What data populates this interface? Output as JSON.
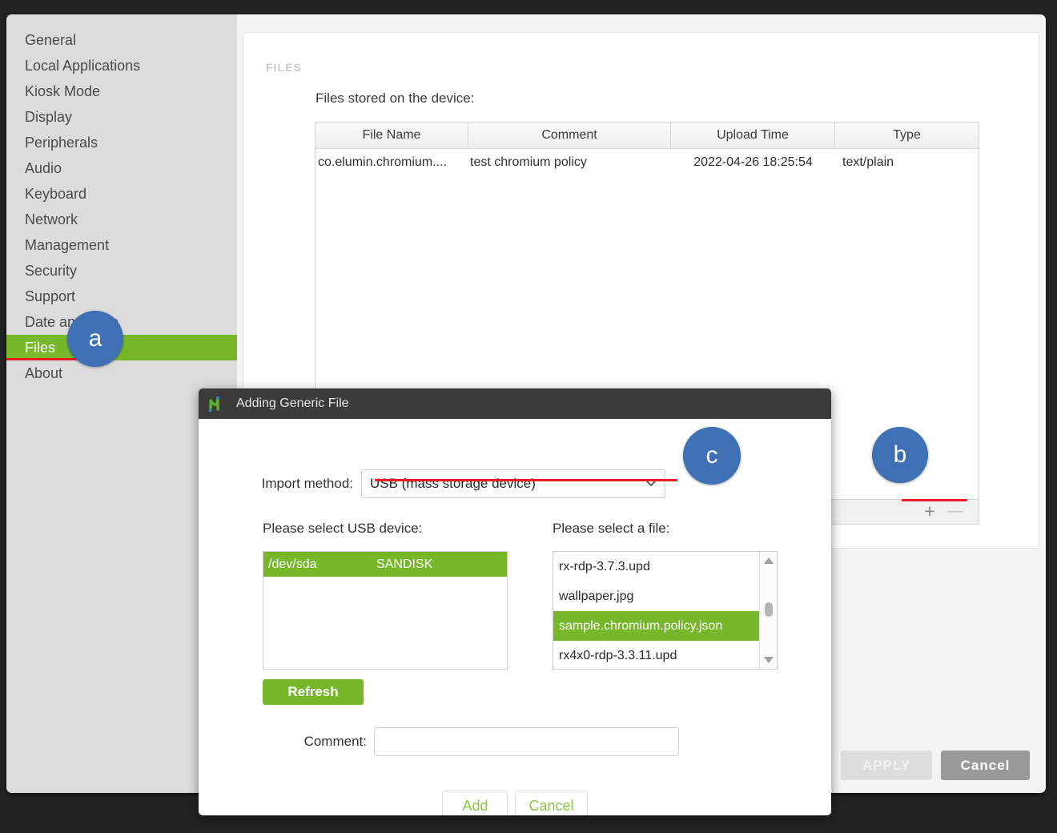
{
  "sidebar": {
    "items": [
      {
        "label": "General",
        "selected": false
      },
      {
        "label": "Local Applications",
        "selected": false
      },
      {
        "label": "Kiosk Mode",
        "selected": false
      },
      {
        "label": "Display",
        "selected": false
      },
      {
        "label": "Peripherals",
        "selected": false
      },
      {
        "label": "Audio",
        "selected": false
      },
      {
        "label": "Keyboard",
        "selected": false
      },
      {
        "label": "Network",
        "selected": false
      },
      {
        "label": "Management",
        "selected": false
      },
      {
        "label": "Security",
        "selected": false
      },
      {
        "label": "Support",
        "selected": false
      },
      {
        "label": "Date and Time",
        "selected": false
      },
      {
        "label": "Files",
        "selected": true
      },
      {
        "label": "About",
        "selected": false
      }
    ]
  },
  "content": {
    "section_label": "FILES",
    "caption": "Files stored on the device:",
    "table": {
      "columns": [
        "File Name",
        "Comment",
        "Upload Time",
        "Type"
      ],
      "rows": [
        {
          "file_name": "co.elumin.chromium....",
          "comment": "test chromium policy",
          "upload_time": "2022-04-26 18:25:54",
          "type": "text/plain"
        }
      ]
    },
    "toolbar": {
      "add_label": "+",
      "remove_label": "—"
    }
  },
  "window_footer": {
    "apply_label": "APPLY",
    "cancel_label": "Cancel"
  },
  "dialog": {
    "title": "Adding Generic File",
    "import_method_label": "Import method:",
    "import_method_value": "USB (mass storage device)",
    "usb_label": "Please select USB device:",
    "file_label": "Please select a file:",
    "usb_devices": [
      {
        "device": "/dev/sda",
        "vendor": "SANDISK",
        "selected": true
      }
    ],
    "files": [
      {
        "name": "rx-rdp-3.7.3.upd",
        "selected": false
      },
      {
        "name": "wallpaper.jpg",
        "selected": false
      },
      {
        "name": "sample.chromium.policy.json",
        "selected": true
      },
      {
        "name": "rx4x0-rdp-3.3.11.upd",
        "selected": false
      }
    ],
    "refresh_label": "Refresh",
    "comment_label": "Comment:",
    "comment_value": "",
    "comment_placeholder": "",
    "add_label": "Add",
    "cancel_label": "Cancel"
  },
  "markers": {
    "a": "a",
    "b": "b",
    "c": "c"
  },
  "colors": {
    "accent_green": "#76b82a",
    "marker_blue": "#3f6fb5",
    "highlight_red": "#ed1c24"
  }
}
